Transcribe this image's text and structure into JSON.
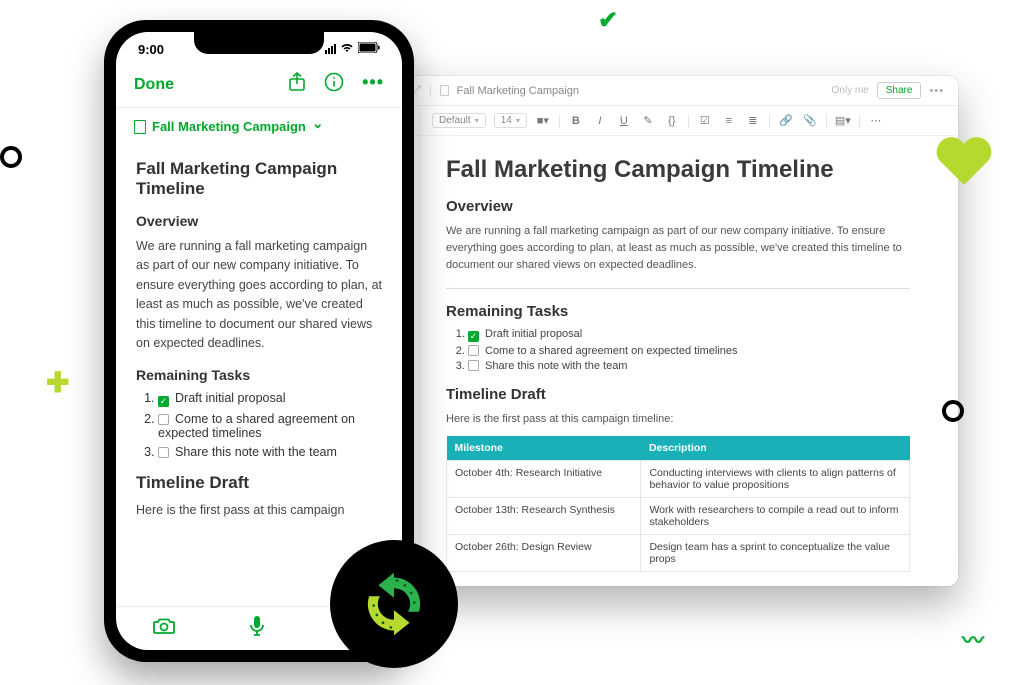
{
  "phone": {
    "time": "9:00",
    "done_label": "Done",
    "breadcrumb": "Fall Marketing Campaign",
    "title": "Fall Marketing Campaign Timeline",
    "section_overview": "Overview",
    "overview_text": "We are running a fall marketing campaign as part of our new company initiative. To ensure everything goes according to plan, at least as much as possible, we've created this timeline to document our shared views on expected deadlines.",
    "section_remaining": "Remaining Tasks",
    "tasks": [
      {
        "label": "Draft initial proposal",
        "done": true
      },
      {
        "label": "Come to a shared agreement on expected timelines",
        "done": false
      },
      {
        "label": "Share this note with the team",
        "done": false
      }
    ],
    "section_timeline": "Timeline Draft",
    "timeline_intro_short": "Here is the first pass at this campaign"
  },
  "desktop": {
    "breadcrumb": "Fall Marketing Campaign",
    "only_me": "Only me",
    "share": "Share",
    "font_family": "Default",
    "font_size": "14",
    "title": "Fall Marketing Campaign Timeline",
    "section_overview": "Overview",
    "overview_text": "We are running a fall marketing campaign as part of our new company initiative. To ensure everything goes according to plan, at least as much as possible, we've created this timeline to document our shared views on expected deadlines.",
    "section_remaining": "Remaining Tasks",
    "tasks": [
      {
        "label": "Draft initial proposal",
        "done": true
      },
      {
        "label": "Come to a shared agreement on expected timelines",
        "done": false
      },
      {
        "label": "Share this note with the team",
        "done": false
      }
    ],
    "section_timeline": "Timeline Draft",
    "timeline_intro": "Here is the first pass at this campaign timeline:",
    "table": {
      "headers": {
        "milestone": "Milestone",
        "description": "Description"
      },
      "rows": [
        {
          "milestone": "October 4th: Research Initiative",
          "description": "Conducting interviews with clients to align patterns of behavior to value propositions"
        },
        {
          "milestone": "October 13th: Research Synthesis",
          "description": "Work with researchers to compile a read out to inform stakeholders"
        },
        {
          "milestone": "October 26th: Design Review",
          "description": "Design team has a sprint to conceptualize the value props"
        }
      ]
    }
  }
}
